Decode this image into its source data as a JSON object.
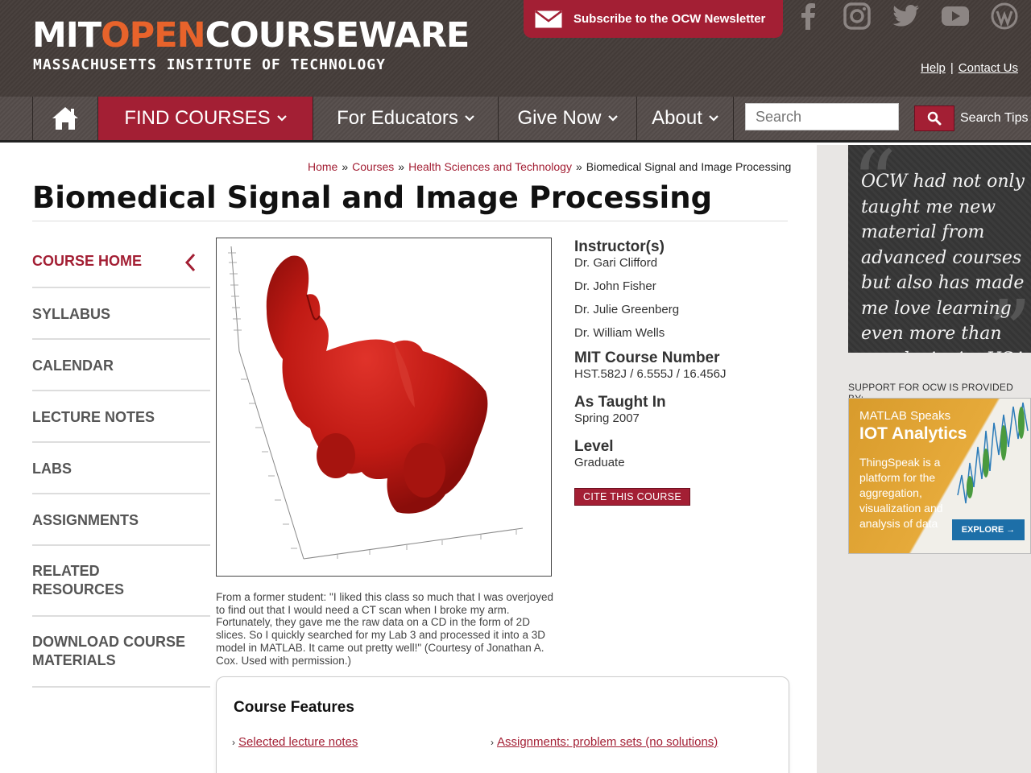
{
  "header": {
    "logo_part1": "MIT",
    "logo_part2": "OPEN",
    "logo_part3": "COURSEWARE",
    "logo_sub": "MASSACHUSETTS INSTITUTE OF TECHNOLOGY",
    "newsletter_label": "Subscribe to the OCW Newsletter",
    "social": [
      "facebook-icon",
      "instagram-icon",
      "twitter-icon",
      "youtube-icon",
      "wordpress-icon"
    ],
    "help_label": "Help",
    "contact_label": "Contact Us",
    "separator": "|"
  },
  "nav": {
    "find_courses": "FIND COURSES",
    "for_educators": "For Educators",
    "give_now": "Give Now",
    "about": "About",
    "search_placeholder": "Search",
    "search_tips": "Search Tips"
  },
  "breadcrumb": {
    "items": [
      "Home",
      "Courses",
      "Health Sciences and Technology"
    ],
    "current": "Biomedical Signal and Image Processing",
    "sep": "»"
  },
  "course": {
    "title": "Biomedical Signal and Image Processing",
    "nav_items": [
      {
        "label": "COURSE HOME",
        "active": true
      },
      {
        "label": "SYLLABUS"
      },
      {
        "label": "CALENDAR"
      },
      {
        "label": "LECTURE NOTES"
      },
      {
        "label": "LABS"
      },
      {
        "label": "ASSIGNMENTS"
      },
      {
        "label": "RELATED RESOURCES"
      },
      {
        "label": "DOWNLOAD COURSE MATERIALS"
      }
    ],
    "caption": "From a former student: \"I liked this class so much that I was overjoyed to find out that I would need a CT scan when I broke my arm. Fortunately, they gave me the raw data on a CD in the form of 2D slices. So I quickly searched for my Lab 3 and processed it into a 3D model in MATLAB. It came out pretty well!\" (Courtesy of Jonathan A. Cox. Used with permission.)",
    "instructors_heading": "Instructor(s)",
    "instructors": [
      "Dr. Gari Clifford",
      "Dr. John Fisher",
      "Dr. Julie Greenberg",
      "Dr. William Wells"
    ],
    "number_heading": "MIT Course Number",
    "number": "HST.582J / 6.555J / 16.456J",
    "taught_heading": "As Taught In",
    "taught": "Spring 2007",
    "level_heading": "Level",
    "level": "Graduate",
    "cite_label": "CITE THIS COURSE",
    "features_title": "Course Features",
    "features": [
      "Selected lecture notes",
      "Assignments: problem sets (no solutions)"
    ]
  },
  "rail": {
    "quote": "OCW had not only taught me new material from advanced courses but also has made me love learning even more than usual. -Arvin, USA",
    "support_label": "SUPPORT FOR OCW IS PROVIDED BY:",
    "ad_line1": "MATLAB Speaks",
    "ad_line2": "IOT Analytics",
    "ad_line3": "ThingSpeak is a platform for the aggregation, visualization and analysis of data",
    "ad_button": "EXPLORE →"
  },
  "colors": {
    "brand_red": "#a31f34",
    "logo_orange": "#e8632b"
  }
}
